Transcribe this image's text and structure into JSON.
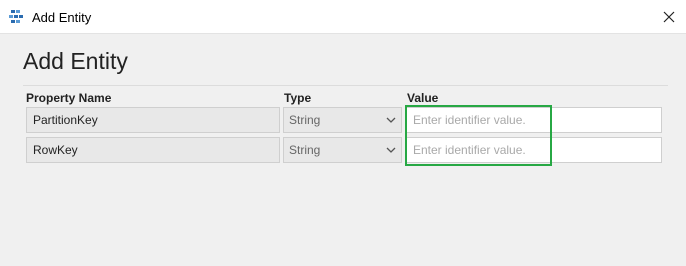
{
  "window": {
    "title": "Add Entity",
    "app_icon": "storage-explorer-icon",
    "close_icon": "close-icon"
  },
  "dialog": {
    "heading": "Add Entity",
    "columns": {
      "name": "Property Name",
      "type": "Type",
      "value": "Value"
    },
    "rows": [
      {
        "name": "PartitionKey",
        "type": "String",
        "value_placeholder": "Enter identifier value."
      },
      {
        "name": "RowKey",
        "type": "String",
        "value_placeholder": "Enter identifier value."
      }
    ]
  },
  "colors": {
    "highlight": "#27a844",
    "background": "#f0f0f0"
  }
}
